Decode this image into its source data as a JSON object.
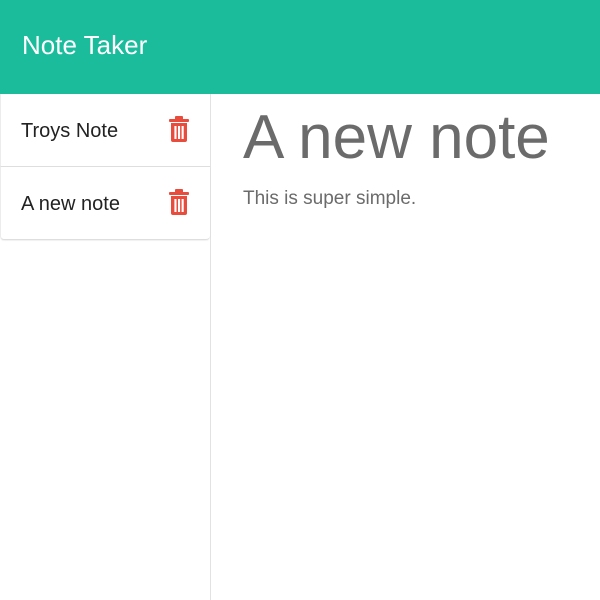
{
  "navbar": {
    "brand": "Note Taker",
    "color": "#1abc9c"
  },
  "sidebar": {
    "notes": [
      {
        "title": "Troys Note",
        "delete_icon": "trash-icon"
      },
      {
        "title": "A new note",
        "delete_icon": "trash-icon"
      }
    ],
    "delete_color": "#e74c3c"
  },
  "active_note": {
    "title": "A new note",
    "text": "This is super simple."
  }
}
